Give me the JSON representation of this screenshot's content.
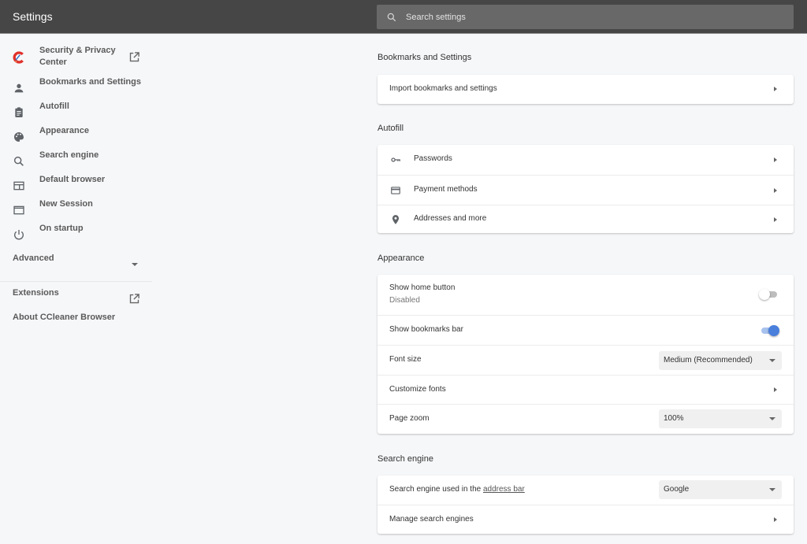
{
  "header": {
    "title": "Settings",
    "search_placeholder": "Search settings"
  },
  "sidebar": {
    "items": [
      {
        "label_line1": "Security & Privacy",
        "label_line2": "Center",
        "icon": "ccleaner-logo-icon",
        "external": true
      },
      {
        "label": "Bookmarks and Settings",
        "icon": "person-icon"
      },
      {
        "label": "Autofill",
        "icon": "clipboard-icon"
      },
      {
        "label": "Appearance",
        "icon": "palette-icon"
      },
      {
        "label": "Search engine",
        "icon": "search-icon"
      },
      {
        "label": "Default browser",
        "icon": "browser-window-icon"
      },
      {
        "label": "New Session",
        "icon": "window-icon"
      },
      {
        "label": "On startup",
        "icon": "power-icon"
      }
    ],
    "advanced": "Advanced",
    "extensions": "Extensions",
    "about": "About CCleaner Browser"
  },
  "sections": {
    "bookmarks": {
      "title": "Bookmarks and Settings",
      "import": "Import bookmarks and settings"
    },
    "autofill": {
      "title": "Autofill",
      "passwords": "Passwords",
      "payment": "Payment methods",
      "addresses": "Addresses and more"
    },
    "appearance": {
      "title": "Appearance",
      "home_button": "Show home button",
      "home_button_status": "Disabled",
      "home_button_on": false,
      "bookmarks_bar": "Show bookmarks bar",
      "bookmarks_bar_on": true,
      "font_size": "Font size",
      "font_size_value": "Medium (Recommended)",
      "customize_fonts": "Customize fonts",
      "page_zoom": "Page zoom",
      "page_zoom_value": "100%"
    },
    "search_engine": {
      "title": "Search engine",
      "used_prefix": "Search engine used in the ",
      "used_link": "address bar",
      "used_value": "Google",
      "manage": "Manage search engines"
    }
  },
  "colors": {
    "header_bg": "#464646",
    "accent": "#4a7fdc",
    "accent_track": "#a8c2ee"
  }
}
